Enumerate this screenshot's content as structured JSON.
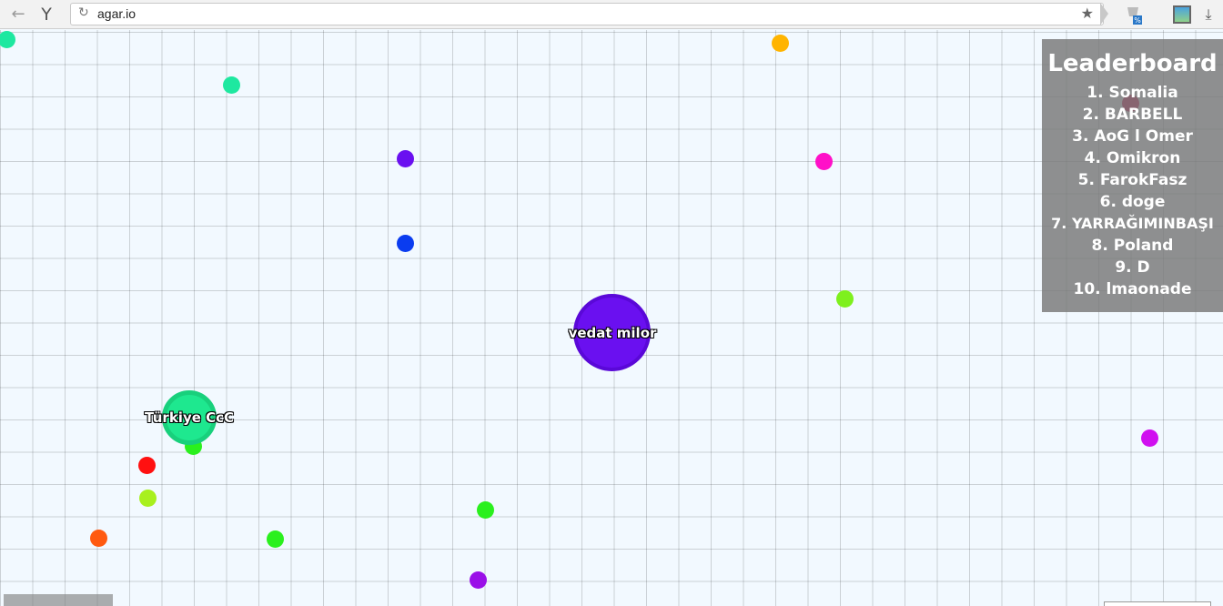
{
  "browser": {
    "back_icon": "back-arrow-icon",
    "logo_glyph": "Y",
    "url": "agar.io",
    "reload_icon": "reload-icon",
    "bookmark_icon": "star-icon"
  },
  "game": {
    "player_cells": [
      {
        "name": "vedat milor",
        "color": "#6a10f0"
      },
      {
        "name": "Türkiye CcC",
        "color": "#1ee88f"
      }
    ],
    "pellet_colors": [
      "#1ee8a0",
      "#1ee8a0",
      "#ffb400",
      "#6a10f0",
      "#ff10c8",
      "#0a3cf0",
      "#7ef01e",
      "#cc1050",
      "#ff1010",
      "#2af01e",
      "#a8f01e",
      "#ff5a10",
      "#2af01e",
      "#2af01e",
      "#9a10e8",
      "#d010f0"
    ]
  },
  "leaderboard": {
    "title": "Leaderboard",
    "entries": [
      "1. Somalia",
      "2. BARBELL",
      "3. AoG l Omer",
      "4. Omikron",
      "5. FarokFasz",
      "6. doge",
      "7. YARRAĞIMINBAŞI",
      "8. Poland",
      "9. D",
      "10. lmaonade"
    ]
  }
}
